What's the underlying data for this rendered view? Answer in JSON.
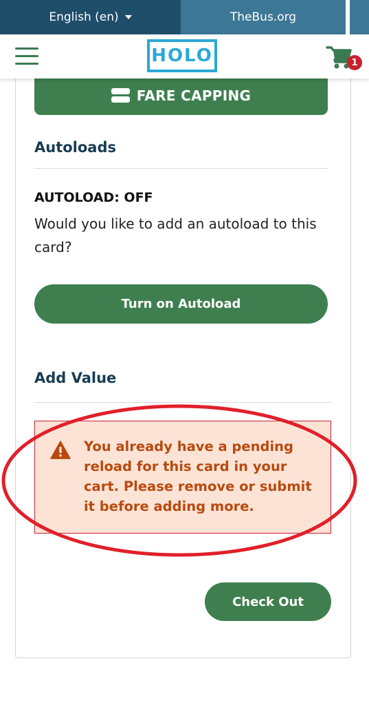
{
  "topbar": {
    "language": "English (en)",
    "site_link": "TheBus.org"
  },
  "header": {
    "logo_text": "HOLO",
    "cart_count": "1"
  },
  "buttons": {
    "fare_capping": "FARE CAPPING",
    "turn_on_autoload": "Turn on Autoload",
    "check_out": "Check Out"
  },
  "autoloads": {
    "heading": "Autoloads",
    "status": "AUTOLOAD: OFF",
    "question": "Would you like to add an autoload to this card?"
  },
  "add_value": {
    "heading": "Add Value",
    "alert_message": "You already have a pending reload for this card in your cart. Please remove or submit it before adding more."
  },
  "colors": {
    "primary_green": "#3f7f4f",
    "alert_bg": "#fde3d6",
    "alert_text": "#b84a0e",
    "annotation_red": "#e0202a",
    "logo_blue": "#2aa9d6"
  }
}
